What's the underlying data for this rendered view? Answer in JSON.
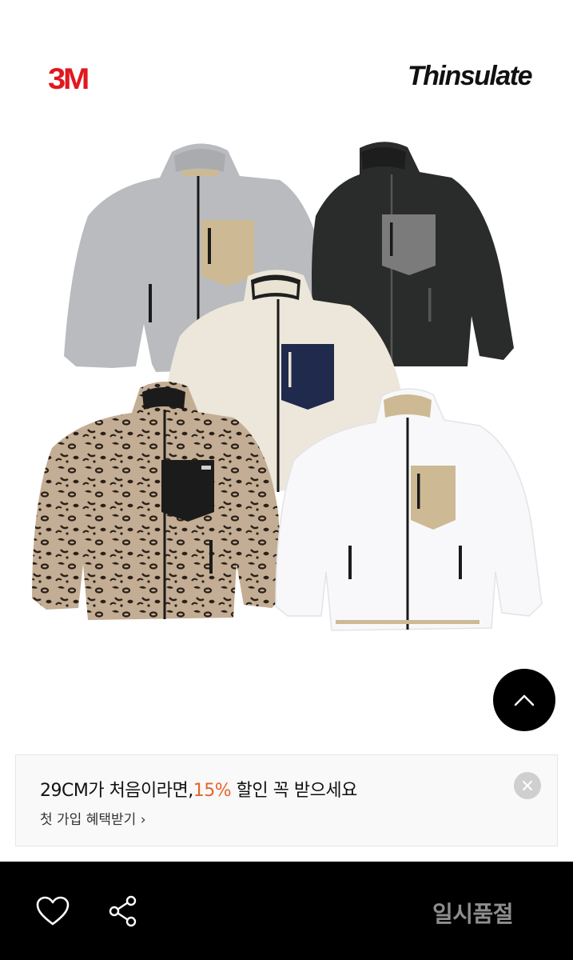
{
  "brands": {
    "left_logo": "3M",
    "right_logo": "Thinsulate"
  },
  "product_image": {
    "items": [
      {
        "name": "grey-jacket",
        "body_color": "#b9bbbf",
        "pocket_color": "#cdb994"
      },
      {
        "name": "black-jacket",
        "body_color": "#2a2c2b",
        "pocket_color": "#7b7b7b"
      },
      {
        "name": "ivory-jacket",
        "body_color": "#ece7da",
        "pocket_color": "#1f2a4c"
      },
      {
        "name": "leopard-jacket",
        "body_color": "#c3ad94",
        "pocket_color": "#1b1b1b"
      },
      {
        "name": "white-jacket",
        "body_color": "#f8f8fa",
        "pocket_color": "#cdb994"
      }
    ]
  },
  "scroll_top": {
    "icon": "chevron-up-icon"
  },
  "promo": {
    "headline_part1": "29CM가 처음이라면,",
    "headline_accent": "15%",
    "headline_part2": " 할인 꼭 받으세요",
    "link_text": "첫 가입 혜택받기 ›",
    "accent_color": "#e8632a",
    "close_icon": "close-icon"
  },
  "bottom_bar": {
    "wish_icon": "heart-icon",
    "share_icon": "share-icon",
    "status_label": "일시품절"
  }
}
